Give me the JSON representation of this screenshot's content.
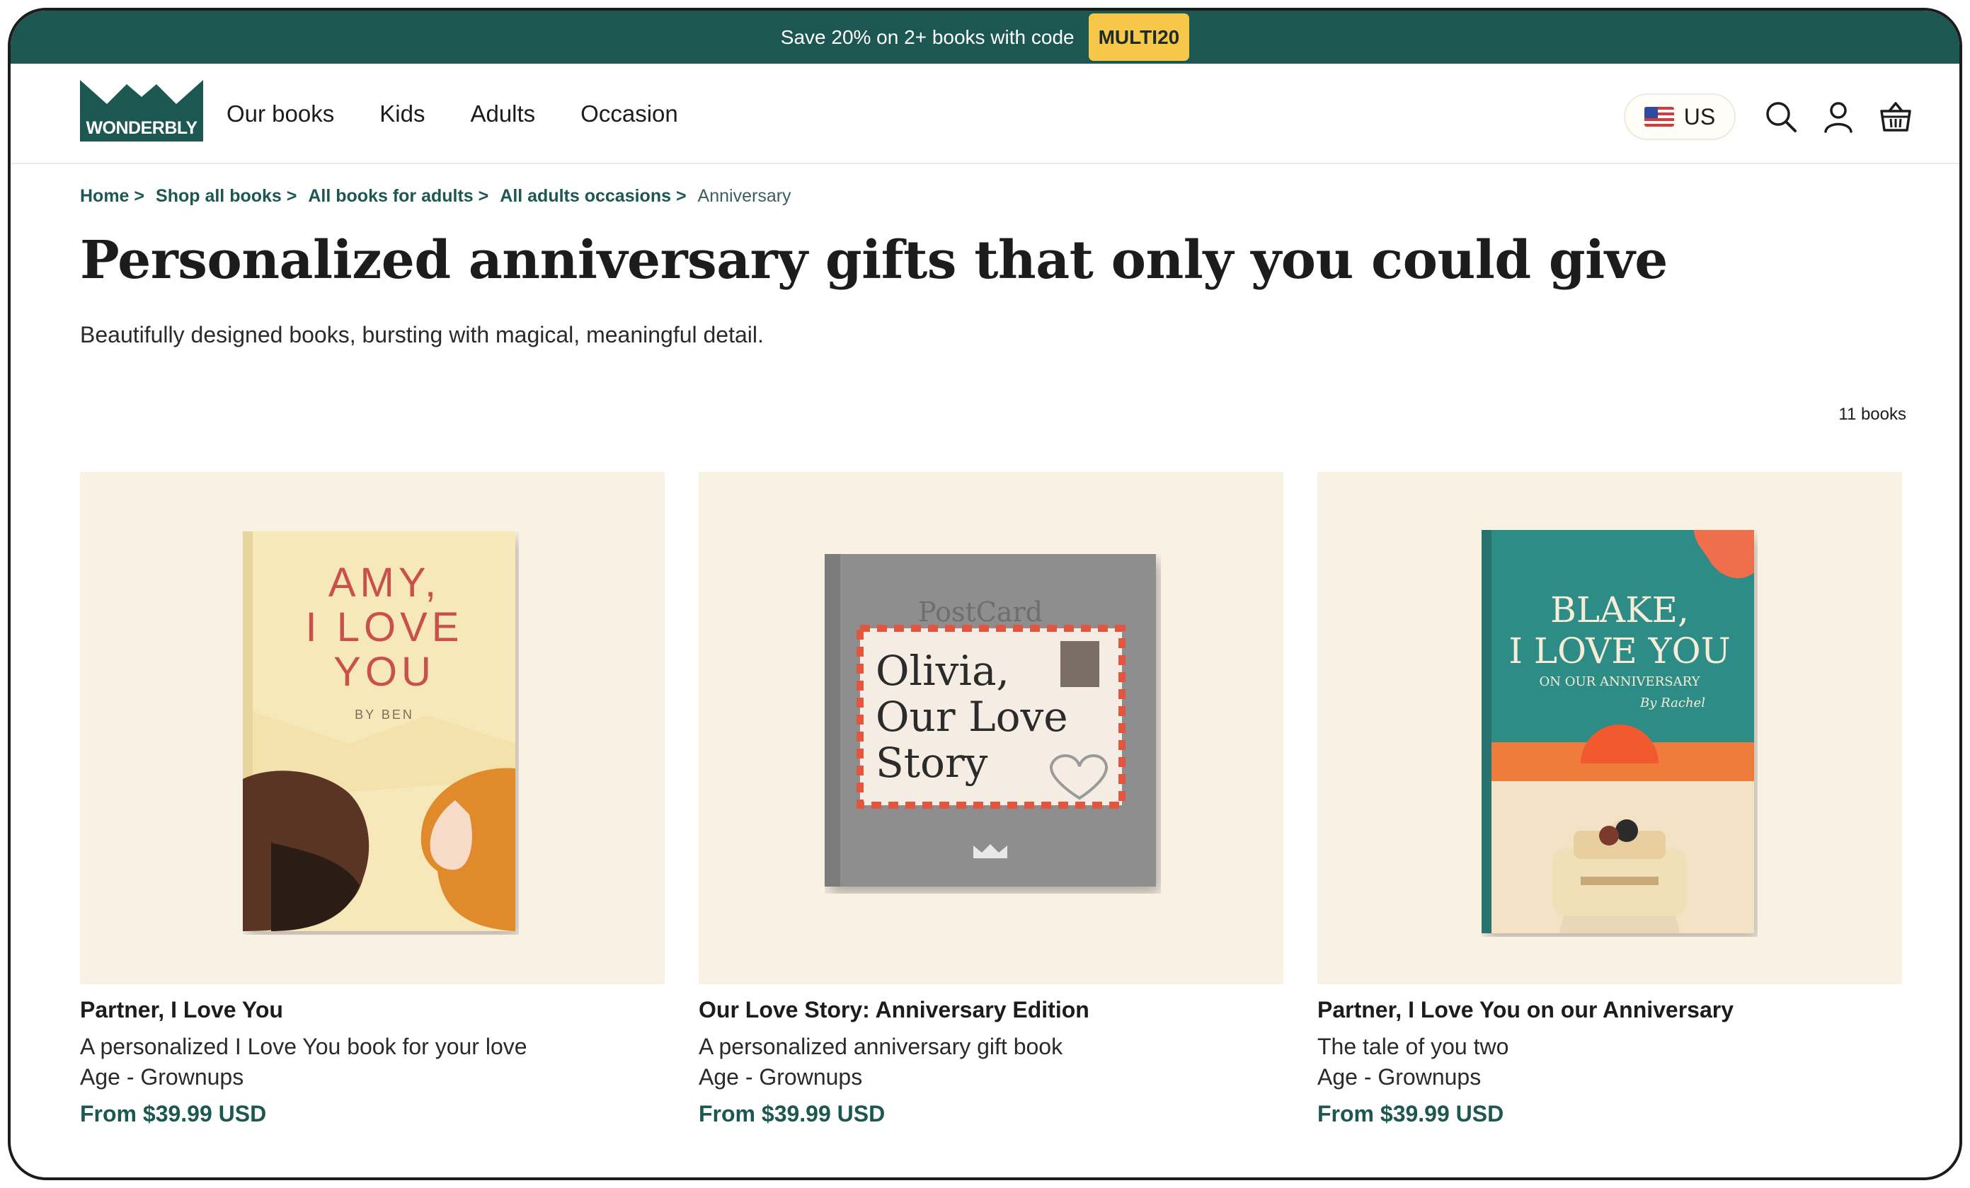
{
  "promo": {
    "text": "Save 20% on 2+ books with code",
    "code": "MULTI20"
  },
  "header": {
    "logo_text": "WONDERBLY",
    "nav": [
      "Our books",
      "Kids",
      "Adults",
      "Occasion"
    ],
    "region": "US"
  },
  "breadcrumb": {
    "items": [
      "Home >",
      "Shop all books >",
      "All books for adults >",
      "All adults occasions >"
    ],
    "current": "Anniversary"
  },
  "page": {
    "title": "Personalized anniversary gifts that only you could give",
    "subtitle": "Beautifully designed books, bursting with magical, meaningful detail.",
    "count": "11 books"
  },
  "products": [
    {
      "name": "Partner, I Love You",
      "description": "A personalized I Love You book for your love",
      "age": "Age - Grownups",
      "price": "From $39.99 USD",
      "cover_lines": [
        "AMY,",
        "I LOVE",
        "YOU"
      ],
      "cover_by": "BY BEN"
    },
    {
      "name": "Our Love Story: Anniversary Edition",
      "description": "A personalized anniversary gift book",
      "age": "Age - Grownups",
      "price": "From $39.99 USD",
      "cover_stamp": "PostCard",
      "cover_lines": [
        "Olivia,",
        "Our Love",
        "Story"
      ]
    },
    {
      "name": "Partner, I Love You on our Anniversary",
      "description": "The tale of you two",
      "age": "Age - Grownups",
      "price": "From $39.99 USD",
      "cover_lines": [
        "BLAKE,",
        "I LOVE YOU"
      ],
      "cover_sub": "ON OUR ANNIVERSARY",
      "cover_by": "By Rachel"
    }
  ]
}
